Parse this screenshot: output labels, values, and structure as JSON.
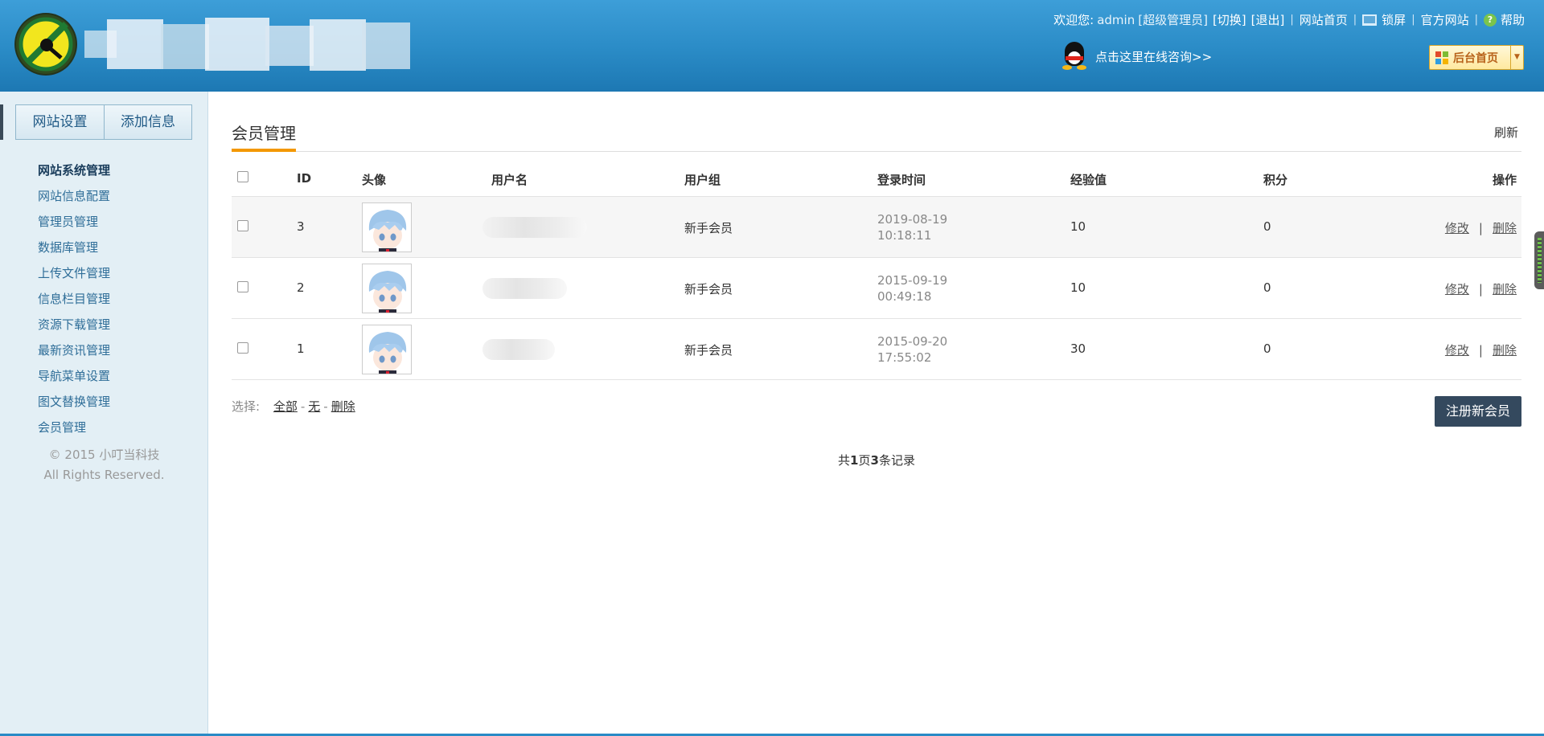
{
  "header": {
    "welcome_prefix": "欢迎您:",
    "admin_name": "admin",
    "admin_role": "[超级管理员]",
    "switch": "[切换]",
    "logout": "[退出]",
    "site_home": "网站首页",
    "lock_screen": "锁屏",
    "official_site": "官方网站",
    "help": "帮助",
    "help_icon_glyph": "?",
    "qq_consult": "点击这里在线咨询>>",
    "admin_home": "后台首页",
    "admin_home_caret": "▼",
    "separator": "|"
  },
  "sidebar": {
    "tabs": [
      "网站设置",
      "添加信息"
    ],
    "items": [
      {
        "label": "网站系统管理",
        "active": true
      },
      {
        "label": "网站信息配置"
      },
      {
        "label": "管理员管理"
      },
      {
        "label": "数据库管理"
      },
      {
        "label": "上传文件管理"
      },
      {
        "label": "信息栏目管理"
      },
      {
        "label": "资源下载管理"
      },
      {
        "label": "最新资讯管理"
      },
      {
        "label": "导航菜单设置"
      },
      {
        "label": "图文替换管理"
      },
      {
        "label": "会员管理"
      }
    ],
    "copyright_line1": "© 2015 小叮当科技",
    "copyright_line2": "All Rights Reserved."
  },
  "main": {
    "title": "会员管理",
    "refresh": "刷新",
    "columns": {
      "id": "ID",
      "avatar": "头像",
      "username": "用户名",
      "group": "用户组",
      "login_time": "登录时间",
      "exp": "经验值",
      "points": "积分",
      "actions": "操作"
    },
    "rows": [
      {
        "id": "3",
        "group": "新手会员",
        "date": "2019-08-19",
        "time": "10:18:11",
        "exp": "10",
        "points": "0",
        "edit": "修改",
        "delete": "删除"
      },
      {
        "id": "2",
        "group": "新手会员",
        "date": "2015-09-19",
        "time": "00:49:18",
        "exp": "10",
        "points": "0",
        "edit": "修改",
        "delete": "删除"
      },
      {
        "id": "1",
        "group": "新手会员",
        "date": "2015-09-20",
        "time": "17:55:02",
        "exp": "30",
        "points": "0",
        "edit": "修改",
        "delete": "删除"
      }
    ],
    "select_label": "选择:",
    "select_all": "全部",
    "select_none": "无",
    "select_delete": "删除",
    "select_dash": "-",
    "register_button": "注册新会员",
    "pager": {
      "prefix": "共",
      "pages": "1",
      "pages_unit": "页",
      "records": "3",
      "records_unit": "条记录"
    }
  },
  "colors": {
    "header_blue": "#2a8bc6",
    "accent_orange": "#f39800",
    "sidebar_bg": "#e3eff5",
    "button_dark": "#34495e"
  }
}
